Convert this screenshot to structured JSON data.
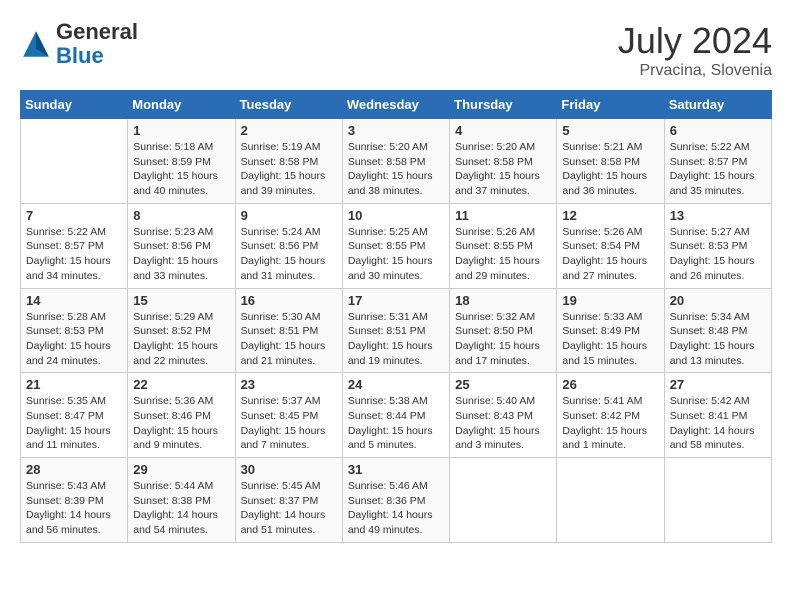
{
  "header": {
    "logo_general": "General",
    "logo_blue": "Blue",
    "month_year": "July 2024",
    "location": "Prvacina, Slovenia"
  },
  "columns": [
    "Sunday",
    "Monday",
    "Tuesday",
    "Wednesday",
    "Thursday",
    "Friday",
    "Saturday"
  ],
  "weeks": [
    [
      {
        "day": "",
        "sunrise": "",
        "sunset": "",
        "daylight": ""
      },
      {
        "day": "1",
        "sunrise": "Sunrise: 5:18 AM",
        "sunset": "Sunset: 8:59 PM",
        "daylight": "Daylight: 15 hours and 40 minutes."
      },
      {
        "day": "2",
        "sunrise": "Sunrise: 5:19 AM",
        "sunset": "Sunset: 8:58 PM",
        "daylight": "Daylight: 15 hours and 39 minutes."
      },
      {
        "day": "3",
        "sunrise": "Sunrise: 5:20 AM",
        "sunset": "Sunset: 8:58 PM",
        "daylight": "Daylight: 15 hours and 38 minutes."
      },
      {
        "day": "4",
        "sunrise": "Sunrise: 5:20 AM",
        "sunset": "Sunset: 8:58 PM",
        "daylight": "Daylight: 15 hours and 37 minutes."
      },
      {
        "day": "5",
        "sunrise": "Sunrise: 5:21 AM",
        "sunset": "Sunset: 8:58 PM",
        "daylight": "Daylight: 15 hours and 36 minutes."
      },
      {
        "day": "6",
        "sunrise": "Sunrise: 5:22 AM",
        "sunset": "Sunset: 8:57 PM",
        "daylight": "Daylight: 15 hours and 35 minutes."
      }
    ],
    [
      {
        "day": "7",
        "sunrise": "Sunrise: 5:22 AM",
        "sunset": "Sunset: 8:57 PM",
        "daylight": "Daylight: 15 hours and 34 minutes."
      },
      {
        "day": "8",
        "sunrise": "Sunrise: 5:23 AM",
        "sunset": "Sunset: 8:56 PM",
        "daylight": "Daylight: 15 hours and 33 minutes."
      },
      {
        "day": "9",
        "sunrise": "Sunrise: 5:24 AM",
        "sunset": "Sunset: 8:56 PM",
        "daylight": "Daylight: 15 hours and 31 minutes."
      },
      {
        "day": "10",
        "sunrise": "Sunrise: 5:25 AM",
        "sunset": "Sunset: 8:55 PM",
        "daylight": "Daylight: 15 hours and 30 minutes."
      },
      {
        "day": "11",
        "sunrise": "Sunrise: 5:26 AM",
        "sunset": "Sunset: 8:55 PM",
        "daylight": "Daylight: 15 hours and 29 minutes."
      },
      {
        "day": "12",
        "sunrise": "Sunrise: 5:26 AM",
        "sunset": "Sunset: 8:54 PM",
        "daylight": "Daylight: 15 hours and 27 minutes."
      },
      {
        "day": "13",
        "sunrise": "Sunrise: 5:27 AM",
        "sunset": "Sunset: 8:53 PM",
        "daylight": "Daylight: 15 hours and 26 minutes."
      }
    ],
    [
      {
        "day": "14",
        "sunrise": "Sunrise: 5:28 AM",
        "sunset": "Sunset: 8:53 PM",
        "daylight": "Daylight: 15 hours and 24 minutes."
      },
      {
        "day": "15",
        "sunrise": "Sunrise: 5:29 AM",
        "sunset": "Sunset: 8:52 PM",
        "daylight": "Daylight: 15 hours and 22 minutes."
      },
      {
        "day": "16",
        "sunrise": "Sunrise: 5:30 AM",
        "sunset": "Sunset: 8:51 PM",
        "daylight": "Daylight: 15 hours and 21 minutes."
      },
      {
        "day": "17",
        "sunrise": "Sunrise: 5:31 AM",
        "sunset": "Sunset: 8:51 PM",
        "daylight": "Daylight: 15 hours and 19 minutes."
      },
      {
        "day": "18",
        "sunrise": "Sunrise: 5:32 AM",
        "sunset": "Sunset: 8:50 PM",
        "daylight": "Daylight: 15 hours and 17 minutes."
      },
      {
        "day": "19",
        "sunrise": "Sunrise: 5:33 AM",
        "sunset": "Sunset: 8:49 PM",
        "daylight": "Daylight: 15 hours and 15 minutes."
      },
      {
        "day": "20",
        "sunrise": "Sunrise: 5:34 AM",
        "sunset": "Sunset: 8:48 PM",
        "daylight": "Daylight: 15 hours and 13 minutes."
      }
    ],
    [
      {
        "day": "21",
        "sunrise": "Sunrise: 5:35 AM",
        "sunset": "Sunset: 8:47 PM",
        "daylight": "Daylight: 15 hours and 11 minutes."
      },
      {
        "day": "22",
        "sunrise": "Sunrise: 5:36 AM",
        "sunset": "Sunset: 8:46 PM",
        "daylight": "Daylight: 15 hours and 9 minutes."
      },
      {
        "day": "23",
        "sunrise": "Sunrise: 5:37 AM",
        "sunset": "Sunset: 8:45 PM",
        "daylight": "Daylight: 15 hours and 7 minutes."
      },
      {
        "day": "24",
        "sunrise": "Sunrise: 5:38 AM",
        "sunset": "Sunset: 8:44 PM",
        "daylight": "Daylight: 15 hours and 5 minutes."
      },
      {
        "day": "25",
        "sunrise": "Sunrise: 5:40 AM",
        "sunset": "Sunset: 8:43 PM",
        "daylight": "Daylight: 15 hours and 3 minutes."
      },
      {
        "day": "26",
        "sunrise": "Sunrise: 5:41 AM",
        "sunset": "Sunset: 8:42 PM",
        "daylight": "Daylight: 15 hours and 1 minute."
      },
      {
        "day": "27",
        "sunrise": "Sunrise: 5:42 AM",
        "sunset": "Sunset: 8:41 PM",
        "daylight": "Daylight: 14 hours and 58 minutes."
      }
    ],
    [
      {
        "day": "28",
        "sunrise": "Sunrise: 5:43 AM",
        "sunset": "Sunset: 8:39 PM",
        "daylight": "Daylight: 14 hours and 56 minutes."
      },
      {
        "day": "29",
        "sunrise": "Sunrise: 5:44 AM",
        "sunset": "Sunset: 8:38 PM",
        "daylight": "Daylight: 14 hours and 54 minutes."
      },
      {
        "day": "30",
        "sunrise": "Sunrise: 5:45 AM",
        "sunset": "Sunset: 8:37 PM",
        "daylight": "Daylight: 14 hours and 51 minutes."
      },
      {
        "day": "31",
        "sunrise": "Sunrise: 5:46 AM",
        "sunset": "Sunset: 8:36 PM",
        "daylight": "Daylight: 14 hours and 49 minutes."
      },
      {
        "day": "",
        "sunrise": "",
        "sunset": "",
        "daylight": ""
      },
      {
        "day": "",
        "sunrise": "",
        "sunset": "",
        "daylight": ""
      },
      {
        "day": "",
        "sunrise": "",
        "sunset": "",
        "daylight": ""
      }
    ]
  ]
}
